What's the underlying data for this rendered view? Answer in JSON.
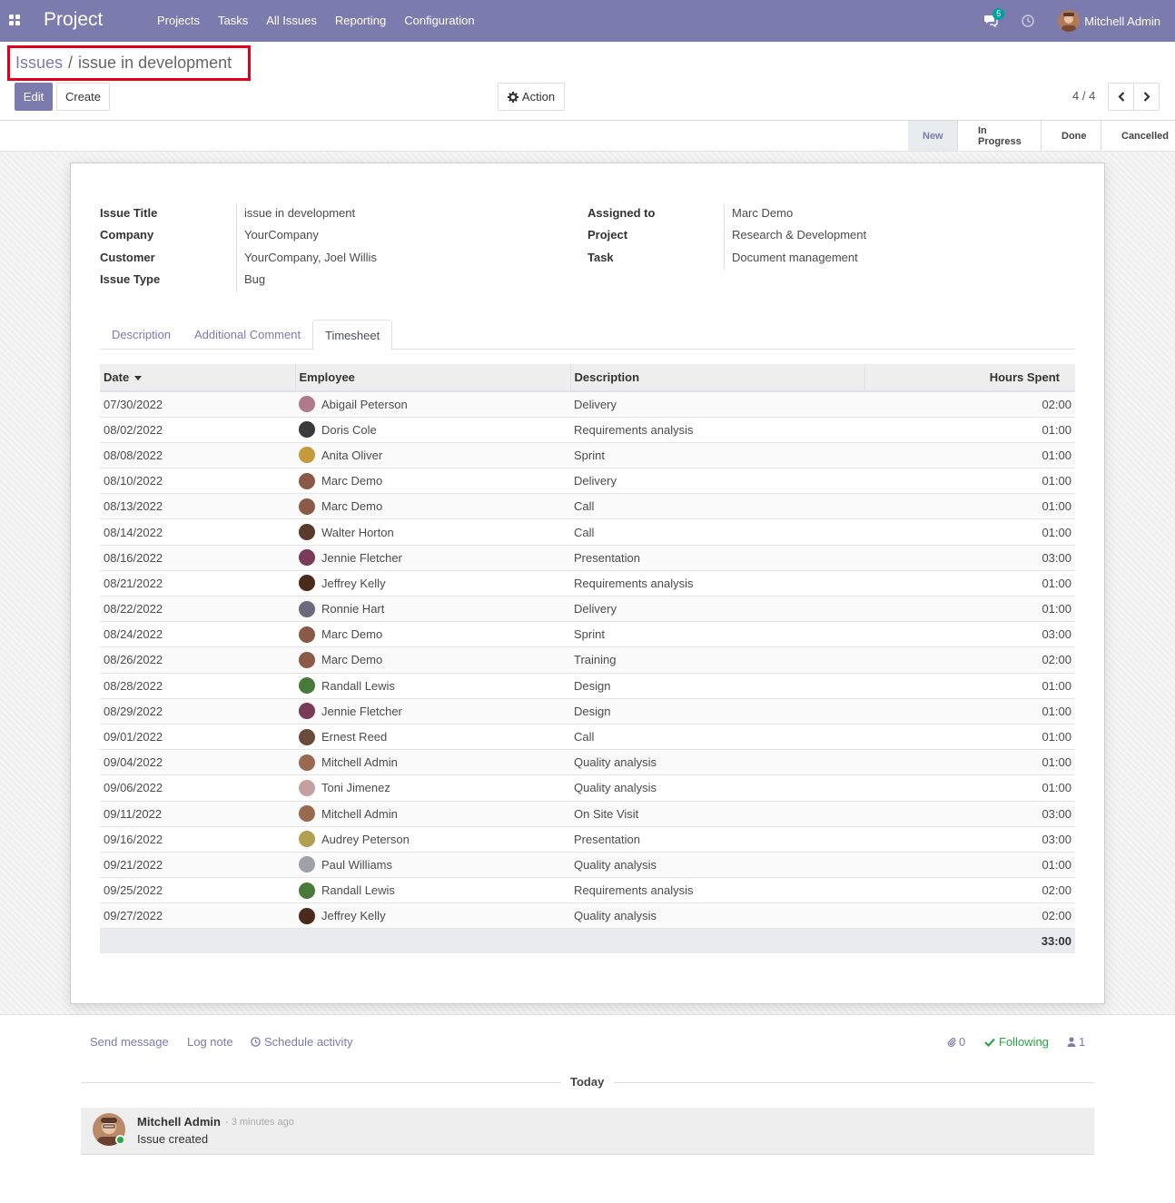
{
  "nav": {
    "app_name": "Project",
    "menu": [
      "Projects",
      "Tasks",
      "All Issues",
      "Reporting",
      "Configuration"
    ],
    "chat_count": "5",
    "user_name": "Mitchell Admin"
  },
  "breadcrumb": {
    "parent": "Issues",
    "separator": "/",
    "current": "issue in development"
  },
  "buttons": {
    "edit": "Edit",
    "create": "Create",
    "action": "Action"
  },
  "pager": {
    "value": "4 / 4"
  },
  "stages": [
    "New",
    "In Progress",
    "Done",
    "Cancelled"
  ],
  "active_stage": "New",
  "form": {
    "left": [
      {
        "label": "Issue Title",
        "value": "issue in development"
      },
      {
        "label": "Company",
        "value": "YourCompany"
      },
      {
        "label": "Customer",
        "value": "YourCompany, Joel Willis"
      },
      {
        "label": "Issue Type",
        "value": "Bug"
      }
    ],
    "right": [
      {
        "label": "Assigned to",
        "value": "Marc Demo"
      },
      {
        "label": "Project",
        "value": "Research & Development"
      },
      {
        "label": "Task",
        "value": "Document management"
      }
    ]
  },
  "tabs": [
    "Description",
    "Additional Comment",
    "Timesheet"
  ],
  "active_tab": "Timesheet",
  "timesheet": {
    "columns": [
      "Date",
      "Employee",
      "Description",
      "Hours Spent"
    ],
    "rows": [
      {
        "date": "07/30/2022",
        "employee": "Abigail Peterson",
        "description": "Delivery",
        "hours": "02:00",
        "avatar_color": "#b07a8a"
      },
      {
        "date": "08/02/2022",
        "employee": "Doris Cole",
        "description": "Requirements analysis",
        "hours": "01:00",
        "avatar_color": "#3a3a3a"
      },
      {
        "date": "08/08/2022",
        "employee": "Anita Oliver",
        "description": "Sprint",
        "hours": "01:00",
        "avatar_color": "#c49a3c"
      },
      {
        "date": "08/10/2022",
        "employee": "Marc Demo",
        "description": "Delivery",
        "hours": "01:00",
        "avatar_color": "#8a5a48"
      },
      {
        "date": "08/13/2022",
        "employee": "Marc Demo",
        "description": "Call",
        "hours": "01:00",
        "avatar_color": "#8a5a48"
      },
      {
        "date": "08/14/2022",
        "employee": "Walter Horton",
        "description": "Call",
        "hours": "01:00",
        "avatar_color": "#5a3a2a"
      },
      {
        "date": "08/16/2022",
        "employee": "Jennie Fletcher",
        "description": "Presentation",
        "hours": "03:00",
        "avatar_color": "#7a3a5a"
      },
      {
        "date": "08/21/2022",
        "employee": "Jeffrey Kelly",
        "description": "Requirements analysis",
        "hours": "01:00",
        "avatar_color": "#4a2a1a"
      },
      {
        "date": "08/22/2022",
        "employee": "Ronnie Hart",
        "description": "Delivery",
        "hours": "01:00",
        "avatar_color": "#6a6a7a"
      },
      {
        "date": "08/24/2022",
        "employee": "Marc Demo",
        "description": "Sprint",
        "hours": "03:00",
        "avatar_color": "#8a5a48"
      },
      {
        "date": "08/26/2022",
        "employee": "Marc Demo",
        "description": "Training",
        "hours": "02:00",
        "avatar_color": "#8a5a48"
      },
      {
        "date": "08/28/2022",
        "employee": "Randall Lewis",
        "description": "Design",
        "hours": "01:00",
        "avatar_color": "#4a7a3a"
      },
      {
        "date": "08/29/2022",
        "employee": "Jennie Fletcher",
        "description": "Design",
        "hours": "01:00",
        "avatar_color": "#7a3a5a"
      },
      {
        "date": "09/01/2022",
        "employee": "Ernest Reed",
        "description": "Call",
        "hours": "01:00",
        "avatar_color": "#6a4a3a"
      },
      {
        "date": "09/04/2022",
        "employee": "Mitchell Admin",
        "description": "Quality analysis",
        "hours": "01:00",
        "avatar_color": "#9a6a50"
      },
      {
        "date": "09/06/2022",
        "employee": "Toni Jimenez",
        "description": "Quality analysis",
        "hours": "01:00",
        "avatar_color": "#c4a0a0"
      },
      {
        "date": "09/11/2022",
        "employee": "Mitchell Admin",
        "description": "On Site Visit",
        "hours": "03:00",
        "avatar_color": "#9a6a50"
      },
      {
        "date": "09/16/2022",
        "employee": "Audrey Peterson",
        "description": "Presentation",
        "hours": "03:00",
        "avatar_color": "#b0a050"
      },
      {
        "date": "09/21/2022",
        "employee": "Paul Williams",
        "description": "Quality analysis",
        "hours": "01:00",
        "avatar_color": "#a0a0a8"
      },
      {
        "date": "09/25/2022",
        "employee": "Randall Lewis",
        "description": "Requirements analysis",
        "hours": "02:00",
        "avatar_color": "#4a7a3a"
      },
      {
        "date": "09/27/2022",
        "employee": "Jeffrey Kelly",
        "description": "Quality analysis",
        "hours": "02:00",
        "avatar_color": "#4a2a1a"
      }
    ],
    "total_hours": "33:00"
  },
  "chatter": {
    "send_message": "Send message",
    "log_note": "Log note",
    "schedule_activity": "Schedule activity",
    "attachments": "0",
    "following": "Following",
    "followers": "1",
    "today": "Today",
    "message": {
      "author": "Mitchell Admin",
      "time": "- 3 minutes ago",
      "body": "Issue created"
    }
  },
  "colors": {
    "brand": "#7c7bad",
    "following": "#28a745",
    "highlight_border": "#e0001b"
  }
}
